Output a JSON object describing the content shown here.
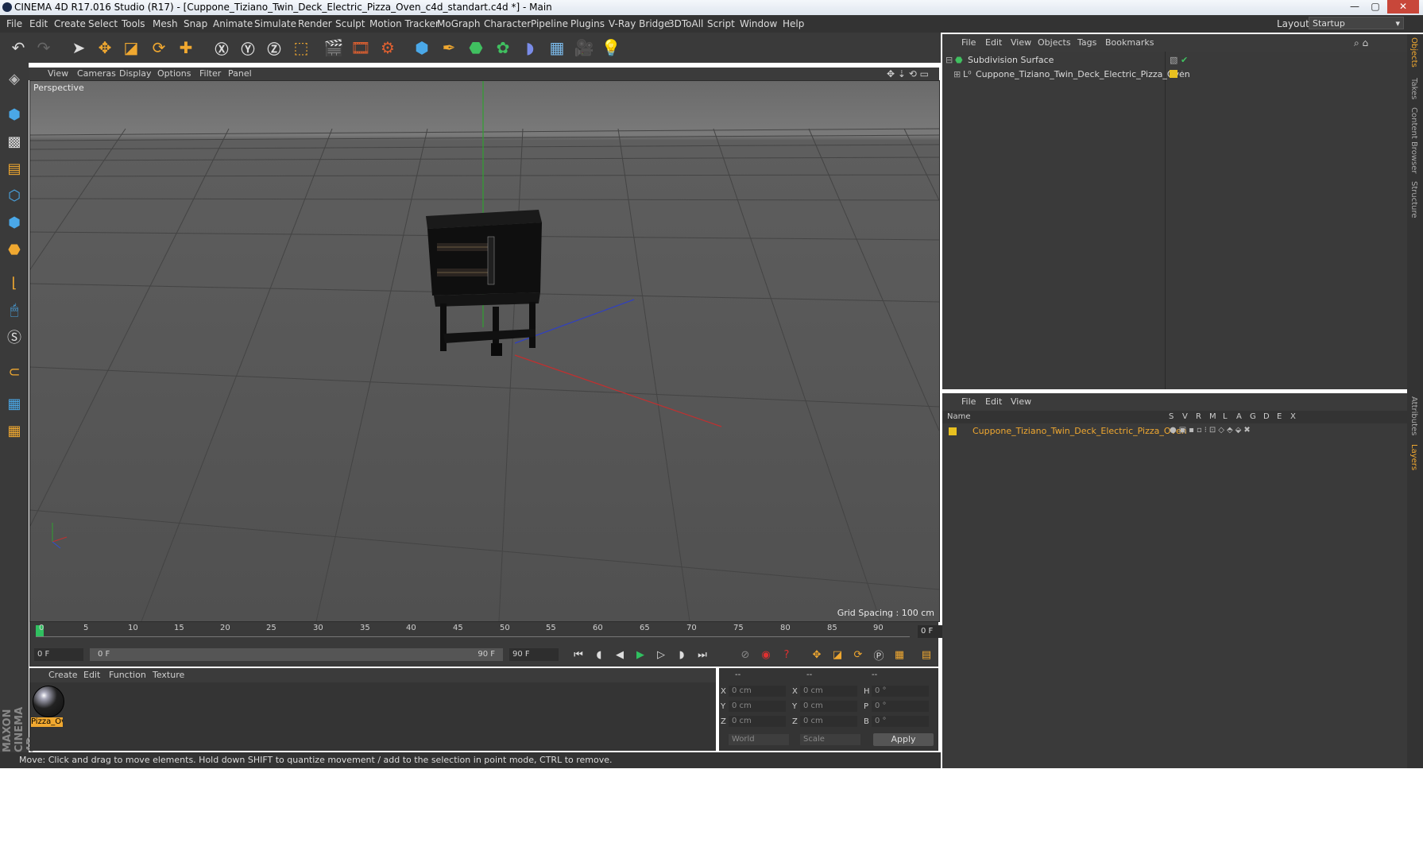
{
  "window": {
    "title": "CINEMA 4D R17.016 Studio (R17) - [Cuppone_Tiziano_Twin_Deck_Electric_Pizza_Oven_c4d_standart.c4d *] - Main",
    "minimize": "—",
    "maximize": "▢",
    "close": "✕"
  },
  "menu": [
    "File",
    "Edit",
    "Create",
    "Select",
    "Tools",
    "Mesh",
    "Snap",
    "Animate",
    "Simulate",
    "Render",
    "Sculpt",
    "Motion Tracker",
    "MoGraph",
    "Character",
    "Pipeline",
    "Plugins",
    "V-Ray Bridge",
    "3DToAll",
    "Script",
    "Window",
    "Help"
  ],
  "layout": {
    "label": "Layout:",
    "value": "Startup"
  },
  "viewport": {
    "menu": [
      "View",
      "Cameras",
      "Display",
      "Options",
      "Filter",
      "Panel"
    ],
    "label": "Perspective",
    "grid_spacing": "Grid Spacing : 100 cm"
  },
  "timeline": {
    "ticks": [
      "0",
      "5",
      "10",
      "15",
      "20",
      "25",
      "30",
      "35",
      "40",
      "45",
      "50",
      "55",
      "60",
      "65",
      "70",
      "75",
      "80",
      "85",
      "90"
    ],
    "current_frame": "0 F",
    "start_field": "0 F",
    "range_start": "0 F",
    "range_end": "90 F",
    "end_field": "90 F"
  },
  "material_manager": {
    "menu": [
      "Create",
      "Edit",
      "Function",
      "Texture"
    ],
    "material_name": "Pizza_Ov"
  },
  "coordinates": {
    "headers": [
      "--",
      "--",
      "--"
    ],
    "rows": [
      {
        "a": "X",
        "av": "0 cm",
        "b": "X",
        "bv": "0 cm",
        "c": "H",
        "cv": "0 °"
      },
      {
        "a": "Y",
        "av": "0 cm",
        "b": "Y",
        "bv": "0 cm",
        "c": "P",
        "cv": "0 °"
      },
      {
        "a": "Z",
        "av": "0 cm",
        "b": "Z",
        "bv": "0 cm",
        "c": "B",
        "cv": "0 °"
      }
    ],
    "space": "World",
    "mode": "Scale",
    "apply": "Apply"
  },
  "status": "Move: Click and drag to move elements. Hold down SHIFT to quantize movement / add to the selection in point mode, CTRL to remove.",
  "object_manager": {
    "menu": [
      "File",
      "Edit",
      "View",
      "Objects",
      "Tags",
      "Bookmarks"
    ],
    "objects": [
      {
        "name": "Subdivision Surface"
      },
      {
        "name": "Cuppone_Tiziano_Twin_Deck_Electric_Pizza_Oven"
      }
    ]
  },
  "layer_manager": {
    "menu": [
      "File",
      "Edit",
      "View"
    ],
    "columns": [
      "Name",
      "S",
      "V",
      "R",
      "M",
      "L",
      "A",
      "G",
      "D",
      "E",
      "X"
    ],
    "layers": [
      {
        "name": "Cuppone_Tiziano_Twin_Deck_Electric_Pizza_Oven",
        "color": "#e8c020"
      }
    ]
  },
  "side_tabs": [
    "Objects",
    "Takes",
    "Content Browser",
    "Structure",
    "Attributes",
    "Layers"
  ],
  "brand": "MAXON CINEMA 4D",
  "colors": {
    "accent": "#f0a830",
    "selected_text": "#f0a830",
    "x_axis": "#d03030",
    "y_axis": "#30b030",
    "z_axis": "#3050d0"
  }
}
